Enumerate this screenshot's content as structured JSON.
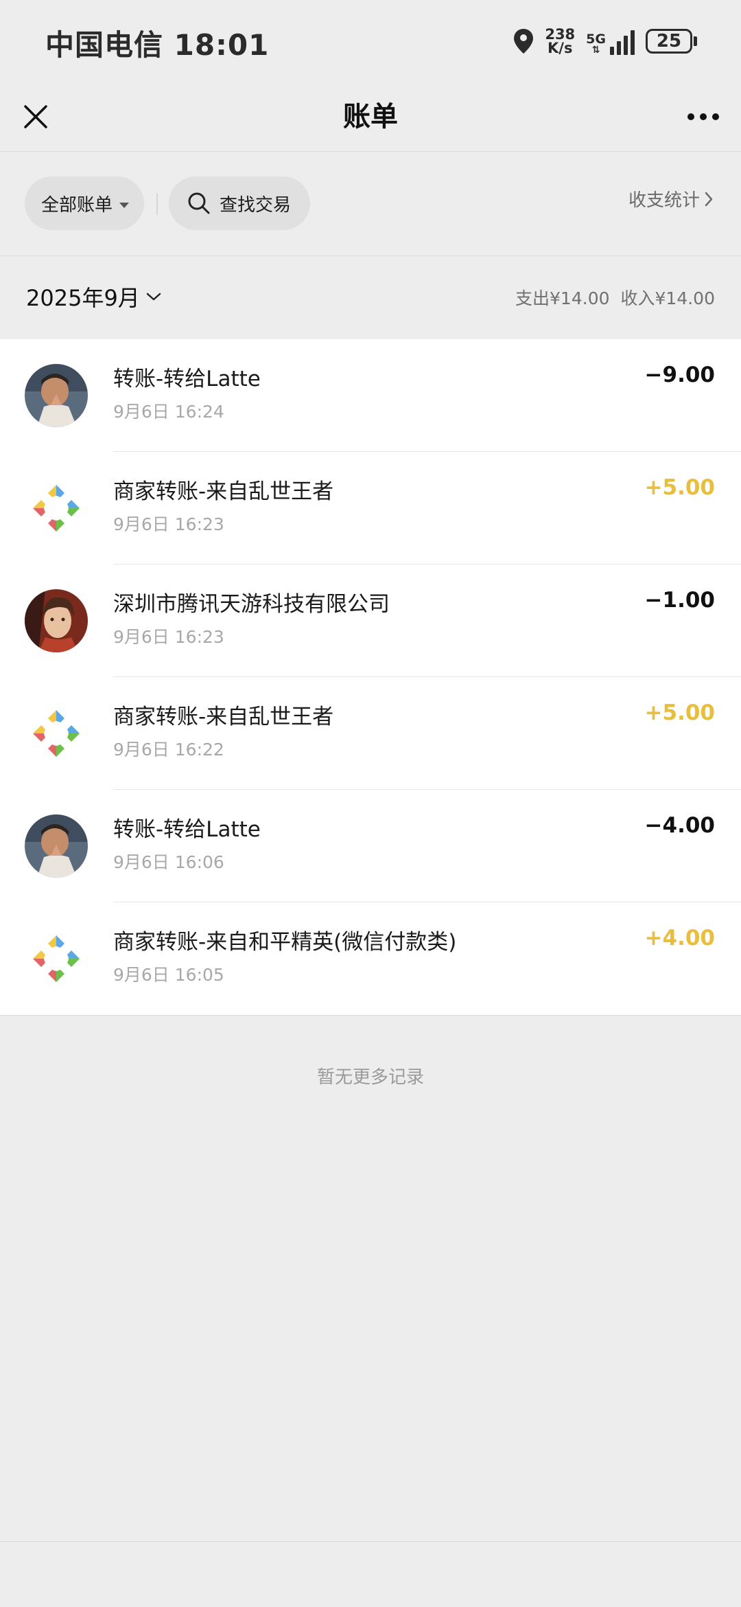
{
  "status_bar": {
    "carrier_time": "中国电信 18:01",
    "net_speed_value": "238",
    "net_speed_unit": "K/s",
    "network": "5G",
    "battery": "25"
  },
  "nav": {
    "title": "账单"
  },
  "filters": {
    "all_bills": "全部账单",
    "search": "查找交易",
    "stats": "收支统计"
  },
  "month": {
    "label": "2025年9月",
    "expense": "支出¥14.00",
    "income": "收入¥14.00"
  },
  "colors": {
    "income": "#e8be3b",
    "expense": "#111111"
  },
  "transactions": [
    {
      "title": "转账-转给Latte",
      "time": "9月6日 16:24",
      "amount": "−9.00",
      "type": "expense",
      "avatar": "person-photo-avatar"
    },
    {
      "title": "商家转账-来自乱世王者",
      "time": "9月6日 16:23",
      "amount": "+5.00",
      "type": "income",
      "avatar": "merchant-logo-icon"
    },
    {
      "title": "深圳市腾讯天游科技有限公司",
      "time": "9月6日 16:23",
      "amount": "−1.00",
      "type": "expense",
      "avatar": "game-character-avatar"
    },
    {
      "title": "商家转账-来自乱世王者",
      "time": "9月6日 16:22",
      "amount": "+5.00",
      "type": "income",
      "avatar": "merchant-logo-icon"
    },
    {
      "title": "转账-转给Latte",
      "time": "9月6日 16:06",
      "amount": "−4.00",
      "type": "expense",
      "avatar": "person-photo-avatar"
    },
    {
      "title": "商家转账-来自和平精英(微信付款类)",
      "time": "9月6日 16:05",
      "amount": "+4.00",
      "type": "income",
      "avatar": "merchant-logo-icon"
    }
  ],
  "footer": {
    "no_more": "暂无更多记录"
  }
}
